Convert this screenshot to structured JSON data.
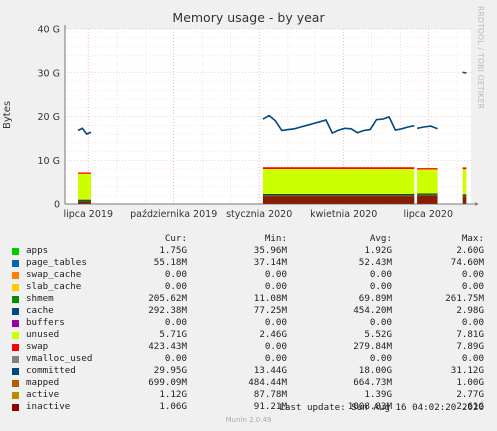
{
  "side_label": "RRDTOOL / TOBI OETIKER",
  "chart_data": {
    "type": "area",
    "title": "Memory usage - by year",
    "ylabel": "Bytes",
    "ylim": [
      0,
      40
    ],
    "yunit": "G",
    "yticks": [
      "0",
      "10 G",
      "20 G",
      "30 G",
      "40 G"
    ],
    "x_domain": [
      "2019-06-06",
      "2020-08-16"
    ],
    "xticks": [
      {
        "label": "lipca 2019",
        "date": "2019-07-01"
      },
      {
        "label": "października 2019",
        "date": "2019-10-01"
      },
      {
        "label": "stycznia 2020",
        "date": "2020-01-01"
      },
      {
        "label": "kwietnia 2020",
        "date": "2020-04-01"
      },
      {
        "label": "lipca 2020",
        "date": "2020-07-01"
      }
    ],
    "grid": true,
    "segments": [
      {
        "from": "2019-06-20",
        "to": "2019-07-04",
        "stack": {
          "apps": 0.55,
          "shmem": 0.15,
          "cache": 0.3,
          "unused": 5.9,
          "swap": 0.3
        },
        "committed": [
          16.8,
          17.3,
          16.0,
          16.4
        ]
      },
      {
        "from": "2020-01-05",
        "to": "2020-06-16",
        "stack": {
          "apps": 1.8,
          "shmem": 0.2,
          "cache": 0.3,
          "unused": 5.7,
          "swap": 0.4
        },
        "committed": [
          19.4,
          20.2,
          19.0,
          16.8,
          17.0,
          17.2,
          17.6,
          18.0,
          18.4,
          18.8,
          19.2,
          16.2,
          16.9,
          17.3,
          17.2,
          16.3,
          16.8,
          17.0,
          19.3,
          19.4,
          19.9,
          16.9,
          17.2,
          17.6,
          17.9
        ]
      },
      {
        "from": "2020-06-19",
        "to": "2020-07-11",
        "stack": {
          "apps": 1.9,
          "shmem": 0.2,
          "cache": 0.3,
          "unused": 5.5,
          "swap": 0.3
        },
        "committed": [
          17.3,
          17.6,
          17.8,
          17.2
        ]
      },
      {
        "from": "2020-08-07",
        "to": "2020-08-11",
        "stack": {
          "apps": 1.75,
          "shmem": 0.2,
          "cache": 0.29,
          "unused": 5.71,
          "swap": 0.42
        },
        "committed": [
          30.1,
          29.95
        ]
      }
    ],
    "series": [
      {
        "name": "apps",
        "color": "#00cc00",
        "cur": "1.75G",
        "min": "35.96M",
        "avg": "1.92G",
        "max": "2.60G"
      },
      {
        "name": "page_tables",
        "color": "#0066b3",
        "cur": "55.18M",
        "min": "37.14M",
        "avg": "52.43M",
        "max": "74.60M"
      },
      {
        "name": "swap_cache",
        "color": "#ff8000",
        "cur": "0.00",
        "min": "0.00",
        "avg": "0.00",
        "max": "0.00"
      },
      {
        "name": "slab_cache",
        "color": "#ffcc00",
        "cur": "0.00",
        "min": "0.00",
        "avg": "0.00",
        "max": "0.00"
      },
      {
        "name": "shmem",
        "color": "#330099",
        "cur": "205.62M",
        "min": "11.08M",
        "avg": "69.89M",
        "max": "261.75M"
      },
      {
        "name": "cache",
        "color": "#990099",
        "cur": "292.38M",
        "min": "77.25M",
        "avg": "454.20M",
        "max": "2.98G"
      },
      {
        "name": "buffers",
        "color": "#ccff00",
        "cur": "0.00",
        "min": "0.00",
        "avg": "0.00",
        "max": "0.00"
      },
      {
        "name": "unused",
        "color": "#ff0000",
        "cur": "5.71G",
        "min": "2.46G",
        "avg": "5.52G",
        "max": "7.81G"
      },
      {
        "name": "swap",
        "color": "#808080",
        "cur": "423.43M",
        "min": "0.00",
        "avg": "279.84M",
        "max": "7.89G"
      },
      {
        "name": "vmalloc_used",
        "color": "#008f00",
        "cur": "0.00",
        "min": "0.00",
        "avg": "0.00",
        "max": "0.00"
      },
      {
        "name": "committed",
        "color": "#00487d",
        "cur": "29.95G",
        "min": "13.44G",
        "avg": "18.00G",
        "max": "31.12G"
      },
      {
        "name": "mapped",
        "color": "#b35a00",
        "cur": "699.09M",
        "min": "484.44M",
        "avg": "664.73M",
        "max": "1.00G"
      },
      {
        "name": "active",
        "color": "#b38f00",
        "cur": "1.12G",
        "min": "87.78M",
        "avg": "1.39G",
        "max": "2.77G"
      },
      {
        "name": "inactive",
        "color": "#6b006b",
        "cur": "1.06G",
        "min": "91.21M",
        "avg": "1008.83M",
        "max": "2.61G"
      }
    ],
    "legend_swatches": [
      "#00cc00",
      "#0066b3",
      "#ff8000",
      "#ffcc00",
      "#008f00",
      "#00487d",
      "#990099",
      "#ccff00",
      "#ff0000",
      "#808080",
      "#00487d",
      "#b35a00",
      "#b38f00",
      "#990000"
    ]
  },
  "legend_header": {
    "cur": "Cur:",
    "min": "Min:",
    "avg": "Avg:",
    "max": "Max:"
  },
  "last_update": "Last update: Sun Aug 16 04:02:20 2020",
  "munin_version": "Munin 2.0.49"
}
